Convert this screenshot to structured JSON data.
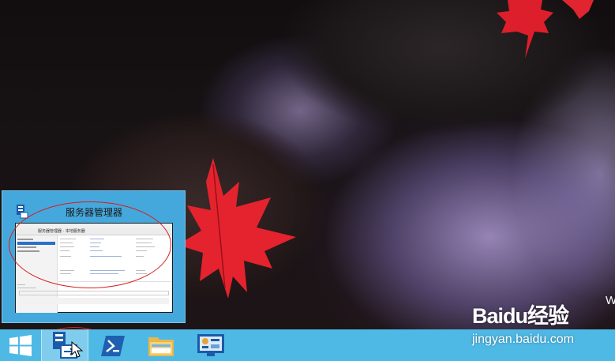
{
  "thumbnail": {
    "title": "服务器管理器",
    "window_nav_text": "服务器管理器 · 本地服务器"
  },
  "taskbar": {
    "items": [
      {
        "icon": "windows-start-icon"
      },
      {
        "icon": "server-manager-icon"
      },
      {
        "icon": "powershell-icon"
      },
      {
        "icon": "file-explorer-icon"
      },
      {
        "icon": "control-panel-icon"
      }
    ],
    "color": "#4fb9e6"
  },
  "desktop": {
    "partial_text": "W"
  },
  "watermark": {
    "logo_text": "Baidu经验",
    "url_text": "jingyan.baidu.com"
  },
  "annotation_color": "#d81e1e"
}
